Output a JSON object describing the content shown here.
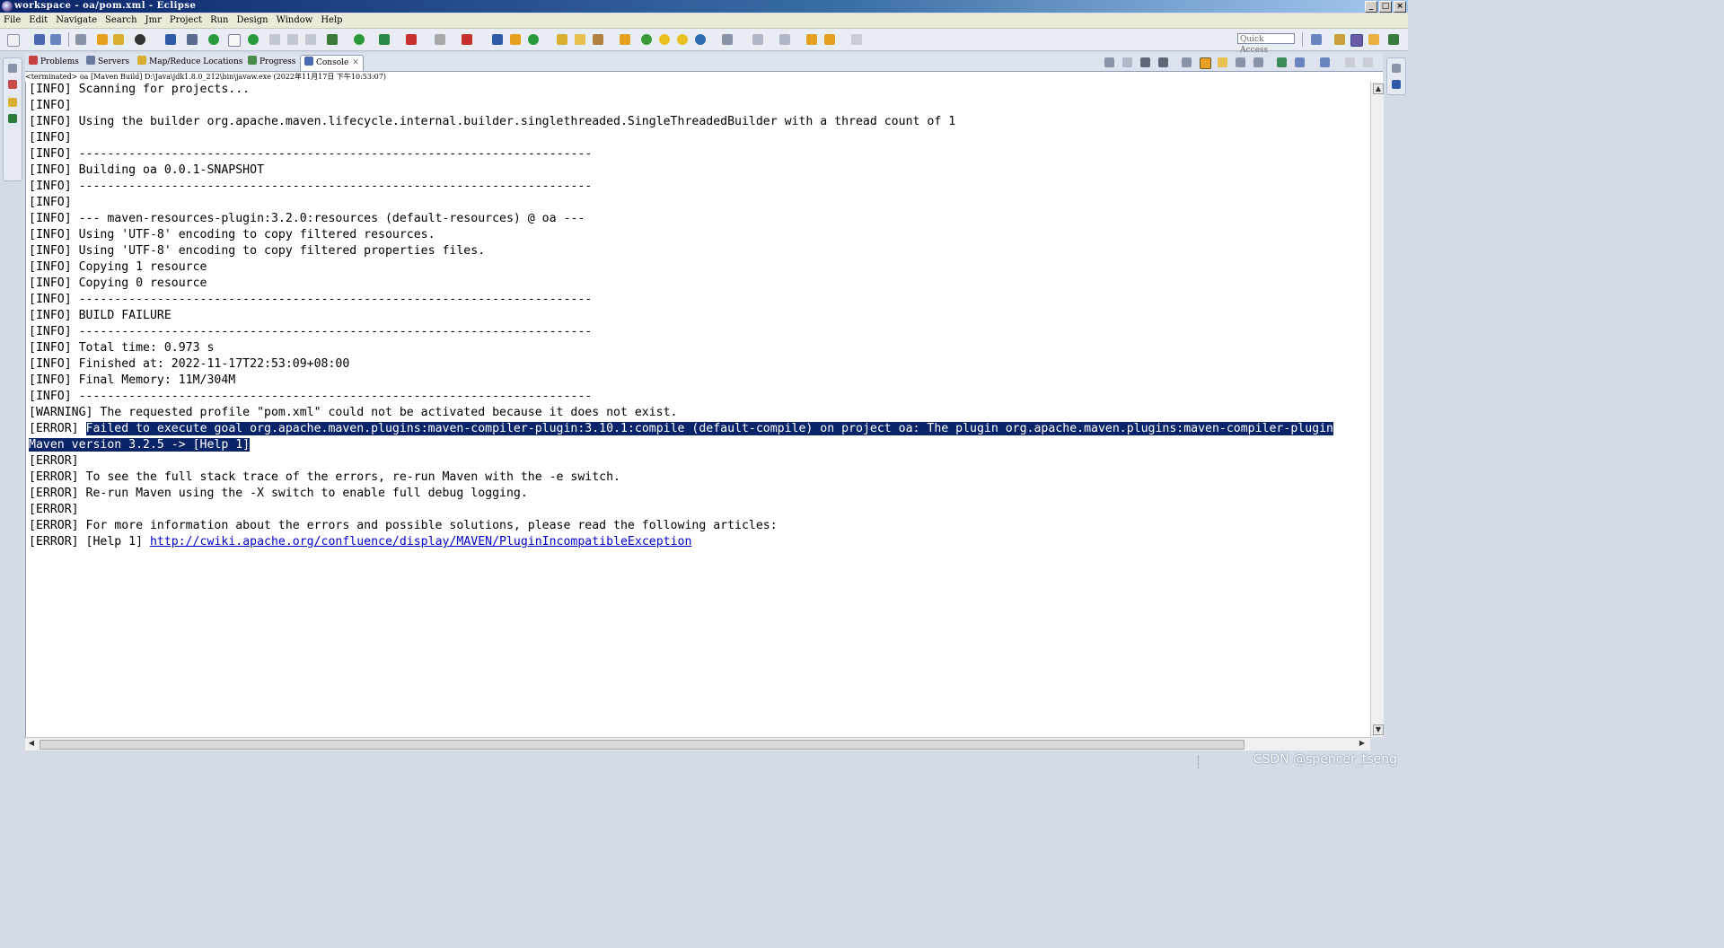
{
  "window": {
    "title": "workspace - oa/pom.xml - Eclipse",
    "buttons": {
      "minimize": "_",
      "maximize": "□",
      "close": "×"
    }
  },
  "menu": [
    "File",
    "Edit",
    "Navigate",
    "Search",
    "Jmr",
    "Project",
    "Run",
    "Design",
    "Window",
    "Help"
  ],
  "toolbar": {
    "quick_access_placeholder": "Quick Access",
    "colors": {
      "green": "#2a9a3a",
      "blue": "#2f5aa8",
      "orange": "#e8a020",
      "red": "#c83030",
      "gray": "#8a94a8",
      "purple": "#7a4aa8"
    }
  },
  "tabs": [
    {
      "label": "Problems",
      "icon": "problems-icon",
      "color": "#c84040"
    },
    {
      "label": "Servers",
      "icon": "servers-icon",
      "color": "#6a7aa0"
    },
    {
      "label": "Map/Reduce Locations",
      "icon": "map-reduce-icon",
      "color": "#d8b030"
    },
    {
      "label": "Progress",
      "icon": "progress-icon",
      "color": "#4a8a4a"
    },
    {
      "label": "Console",
      "icon": "console-icon",
      "color": "#4a6ab0",
      "active": true,
      "close": "✕"
    }
  ],
  "console": {
    "process_line": "<terminated> oa [Maven Build] D:\\Java\\jdk1.8.0_212\\bin\\javaw.exe (2022年11月17日 下午10:53:07)",
    "lines": [
      "[INFO] Scanning for projects...",
      "[INFO]",
      "[INFO] Using the builder org.apache.maven.lifecycle.internal.builder.singlethreaded.SingleThreadedBuilder with a thread count of 1",
      "[INFO]",
      "[INFO] ------------------------------------------------------------------------",
      "[INFO] Building oa 0.0.1-SNAPSHOT",
      "[INFO] ------------------------------------------------------------------------",
      "[INFO]",
      "[INFO] --- maven-resources-plugin:3.2.0:resources (default-resources) @ oa ---",
      "[INFO] Using 'UTF-8' encoding to copy filtered resources.",
      "[INFO] Using 'UTF-8' encoding to copy filtered properties files.",
      "[INFO] Copying 1 resource",
      "[INFO] Copying 0 resource",
      "[INFO] ------------------------------------------------------------------------",
      "[INFO] BUILD FAILURE",
      "[INFO] ------------------------------------------------------------------------",
      "[INFO] Total time: 0.973 s",
      "[INFO] Finished at: 2022-11-17T22:53:09+08:00",
      "[INFO] Final Memory: 11M/304M",
      "[INFO] ------------------------------------------------------------------------",
      "[WARNING] The requested profile \"pom.xml\" could not be activated because it does not exist."
    ],
    "error_prefix": "[ERROR] ",
    "error_selected": "Failed to execute goal org.apache.maven.plugins:maven-compiler-plugin:3.10.1:compile (default-compile) on project oa: The plugin org.apache.maven.plugins:maven-compiler-plugin",
    "error_selected_cont": "Maven version 3.2.5 -> [Help 1]",
    "lines_after": [
      "[ERROR]",
      "[ERROR] To see the full stack trace of the errors, re-run Maven with the -e switch.",
      "[ERROR] Re-run Maven using the -X switch to enable full debug logging.",
      "[ERROR]",
      "[ERROR] For more information about the errors and possible solutions, please read the following articles:"
    ],
    "help_prefix": "[ERROR] [Help 1] ",
    "help_link": "http://cwiki.apache.org/confluence/display/MAVEN/PluginIncompatibleException",
    "selection_color": "#0a246a",
    "link_color": "#0000cc"
  },
  "watermark": "CSDN @spencer_tseng"
}
